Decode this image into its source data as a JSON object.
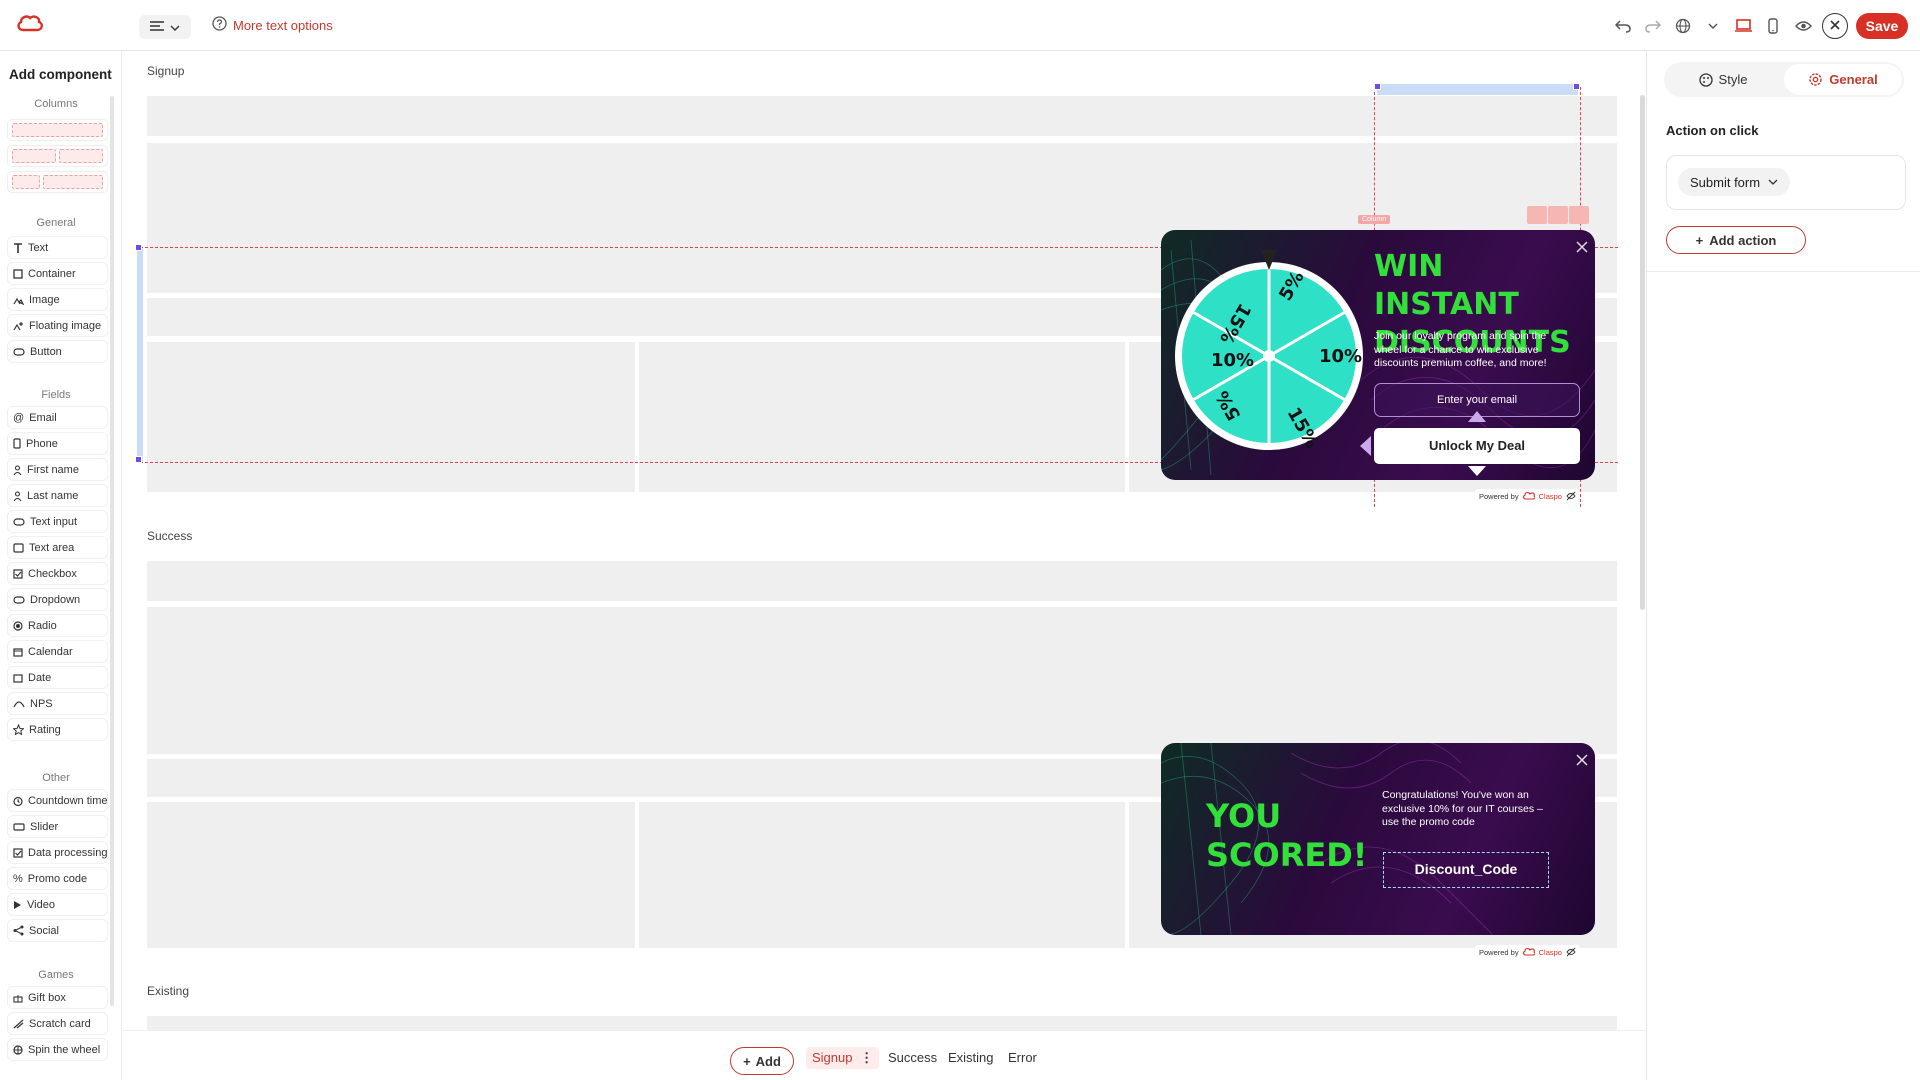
{
  "topbar": {
    "more_text_options": "More text options",
    "save_label": "Save",
    "icons": [
      "cloud-logo-icon",
      "text-align-icon",
      "chevron-down-icon",
      "help-circle-icon",
      "undo-icon",
      "redo-icon",
      "globe-icon",
      "desktop-icon",
      "mobile-icon",
      "eye-icon",
      "close-icon"
    ]
  },
  "sidebar": {
    "title": "Add component",
    "sections": {
      "columns": "Columns",
      "general": "General",
      "fields": "Fields",
      "other": "Other",
      "games": "Games"
    },
    "general_items": [
      "Text",
      "Container",
      "Image",
      "Floating image",
      "Button"
    ],
    "field_items": [
      "Email",
      "Phone",
      "First name",
      "Last name",
      "Text input",
      "Text area",
      "Checkbox",
      "Dropdown",
      "Radio",
      "Calendar",
      "Date",
      "NPS",
      "Rating"
    ],
    "other_items": [
      "Countdown timer",
      "Slider",
      "Data processing",
      "Promo code",
      "Video",
      "Social"
    ],
    "game_items": [
      "Gift box",
      "Scratch card",
      "Spin the wheel"
    ]
  },
  "canvas": {
    "sections": [
      "Signup",
      "Success",
      "Existing"
    ],
    "column_tag": "Column"
  },
  "signup_popup": {
    "title_line1": "WIN INSTANT",
    "title_line2": "DISCOUNTS",
    "description": "Join our loyalty program and spin the wheel for a chance to win exclusive discounts premium coffee, and more!",
    "email_placeholder": "Enter your email",
    "button_label": "Unlock My Deal",
    "wheel_segments": [
      "5%",
      "10%",
      "15%",
      "5%",
      "10%",
      "15%"
    ],
    "colors": {
      "accent": "#32e03a",
      "wheel_teal": "#2ee0c6",
      "popup_bg": "#2a0a3c"
    }
  },
  "success_popup": {
    "title_line1": "YOU",
    "title_line2": "SCORED!",
    "message": "Congratulations! You've won an exclusive 10% for our IT courses – use the promo code",
    "promo_code": "Discount_Code"
  },
  "powered_by": {
    "text": "Powered by",
    "brand": "Claspo"
  },
  "right_panel": {
    "tabs": [
      "Style",
      "General"
    ],
    "active_tab": "General",
    "action_heading": "Action on click",
    "action_value": "Submit form",
    "add_action_label": "Add action"
  },
  "bottom_tabs": {
    "add_label": "Add",
    "pages": [
      "Signup",
      "Success",
      "Existing",
      "Error"
    ],
    "active_page": "Signup"
  }
}
